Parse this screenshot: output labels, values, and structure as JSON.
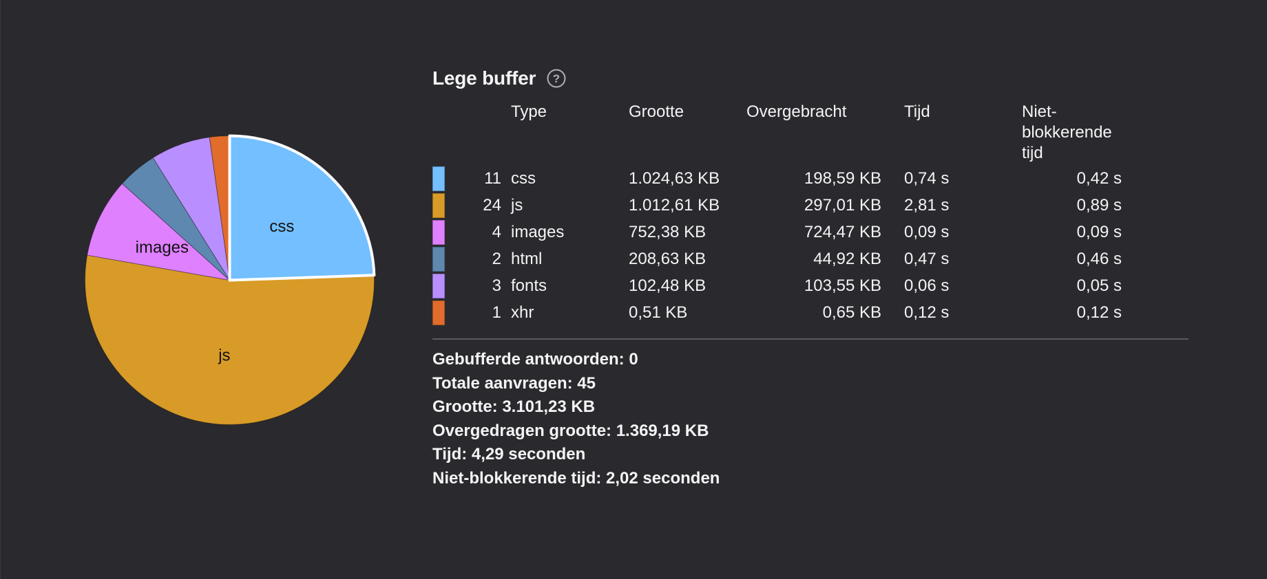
{
  "summary": {
    "title": "Lege buffer",
    "headers": {
      "type": "Type",
      "size": "Grootte",
      "transferred": "Overgebracht",
      "time": "Tijd",
      "non_blocking": "Niet-blokkerende tijd"
    },
    "rows": [
      {
        "color": "#74bfff",
        "count": "11",
        "type": "css",
        "size": "1.024,63 KB",
        "transferred": "198,59 KB",
        "time": "0,74 s",
        "non_blocking": "0,42 s"
      },
      {
        "color": "#d89b28",
        "count": "24",
        "type": "js",
        "size": "1.012,61 KB",
        "transferred": "297,01 KB",
        "time": "2,81 s",
        "non_blocking": "0,89 s"
      },
      {
        "color": "#df80ff",
        "count": "4",
        "type": "images",
        "size": "752,38 KB",
        "transferred": "724,47 KB",
        "time": "0,09 s",
        "non_blocking": "0,09 s"
      },
      {
        "color": "#5e88b0",
        "count": "2",
        "type": "html",
        "size": "208,63 KB",
        "transferred": "44,92 KB",
        "time": "0,47 s",
        "non_blocking": "0,46 s"
      },
      {
        "color": "#b98eff",
        "count": "3",
        "type": "fonts",
        "size": "102,48 KB",
        "transferred": "103,55 KB",
        "time": "0,06 s",
        "non_blocking": "0,05 s"
      },
      {
        "color": "#e16c2b",
        "count": "1",
        "type": "xhr",
        "size": "0,51 KB",
        "transferred": "0,65 KB",
        "time": "0,12 s",
        "non_blocking": "0,12 s"
      }
    ],
    "totals": {
      "cached": "Gebufferde antwoorden: 0",
      "requests": "Totale aanvragen: 45",
      "size": "Grootte: 3.101,23 KB",
      "transferred": "Overgedragen grootte: 1.369,19 KB",
      "time": "Tijd: 4,29 seconden",
      "non_blocking": "Niet-blokkerende tijd: 2,02 seconden"
    }
  },
  "chart_data": {
    "type": "pie",
    "unit": "requests",
    "slices": [
      {
        "label": "css",
        "value": 11,
        "color": "#74bfff",
        "selected": true,
        "show_label": true
      },
      {
        "label": "js",
        "value": 24,
        "color": "#d89b28",
        "selected": false,
        "show_label": true
      },
      {
        "label": "images",
        "value": 4,
        "color": "#df80ff",
        "selected": false,
        "show_label": true
      },
      {
        "label": "html",
        "value": 2,
        "color": "#5e88b0",
        "selected": false,
        "show_label": false
      },
      {
        "label": "fonts",
        "value": 3,
        "color": "#b98eff",
        "selected": false,
        "show_label": false
      },
      {
        "label": "xhr",
        "value": 1,
        "color": "#e16c2b",
        "selected": false,
        "show_label": false
      }
    ]
  }
}
